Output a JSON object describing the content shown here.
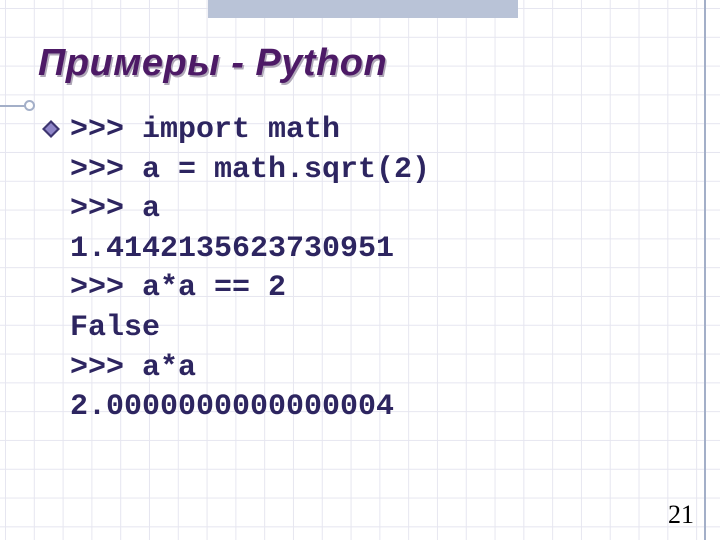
{
  "slide": {
    "title": "Примеры - Python",
    "page_number": "21"
  },
  "code": {
    "lines": [
      ">>> import math",
      ">>> a = math.sqrt(2)",
      ">>> a",
      "1.4142135623730951",
      ">>> a*a == 2",
      "False",
      ">>> a*a",
      "2.0000000000000004"
    ]
  },
  "colors": {
    "title": "#4d1a66",
    "code": "#2d2560",
    "grid": "#e6e6f0",
    "accent": "#a3afc8"
  }
}
